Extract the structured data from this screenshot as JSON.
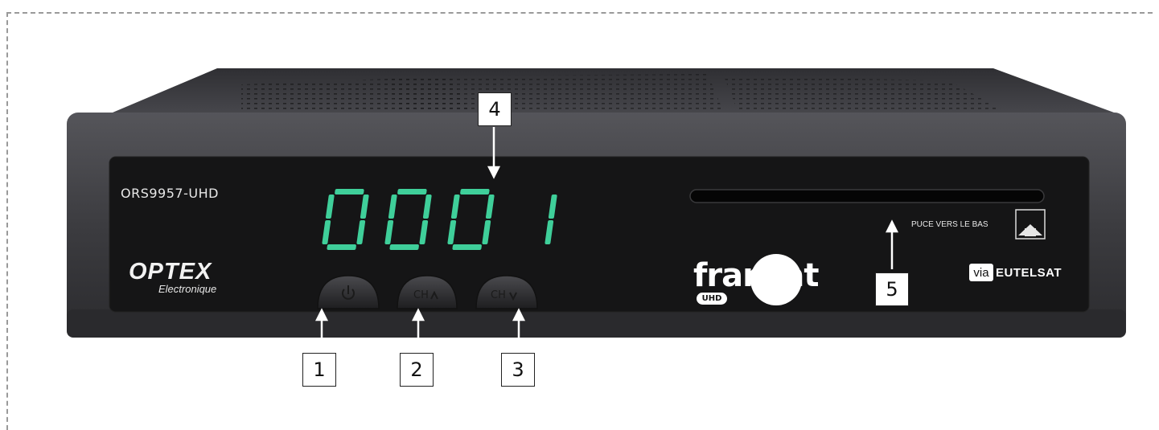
{
  "device": {
    "model": "ORS9957-UHD",
    "display_digits": "0001",
    "display_color": "#3fcf9a",
    "brand": {
      "name": "OPTEX",
      "subtitle": "Electronique"
    },
    "card_slot_label": "PUCE VERS LE BAS",
    "fransat": {
      "word": "fransat",
      "badge": "UHD"
    },
    "satellite": {
      "via": "via",
      "name": "EUTELSAT"
    }
  },
  "buttons": [
    {
      "label": "",
      "icon": "power-icon"
    },
    {
      "label": "CH",
      "icon": "chevron-up-icon"
    },
    {
      "label": "CH",
      "icon": "chevron-down-icon"
    }
  ],
  "callouts": [
    "1",
    "2",
    "3",
    "4",
    "5"
  ]
}
